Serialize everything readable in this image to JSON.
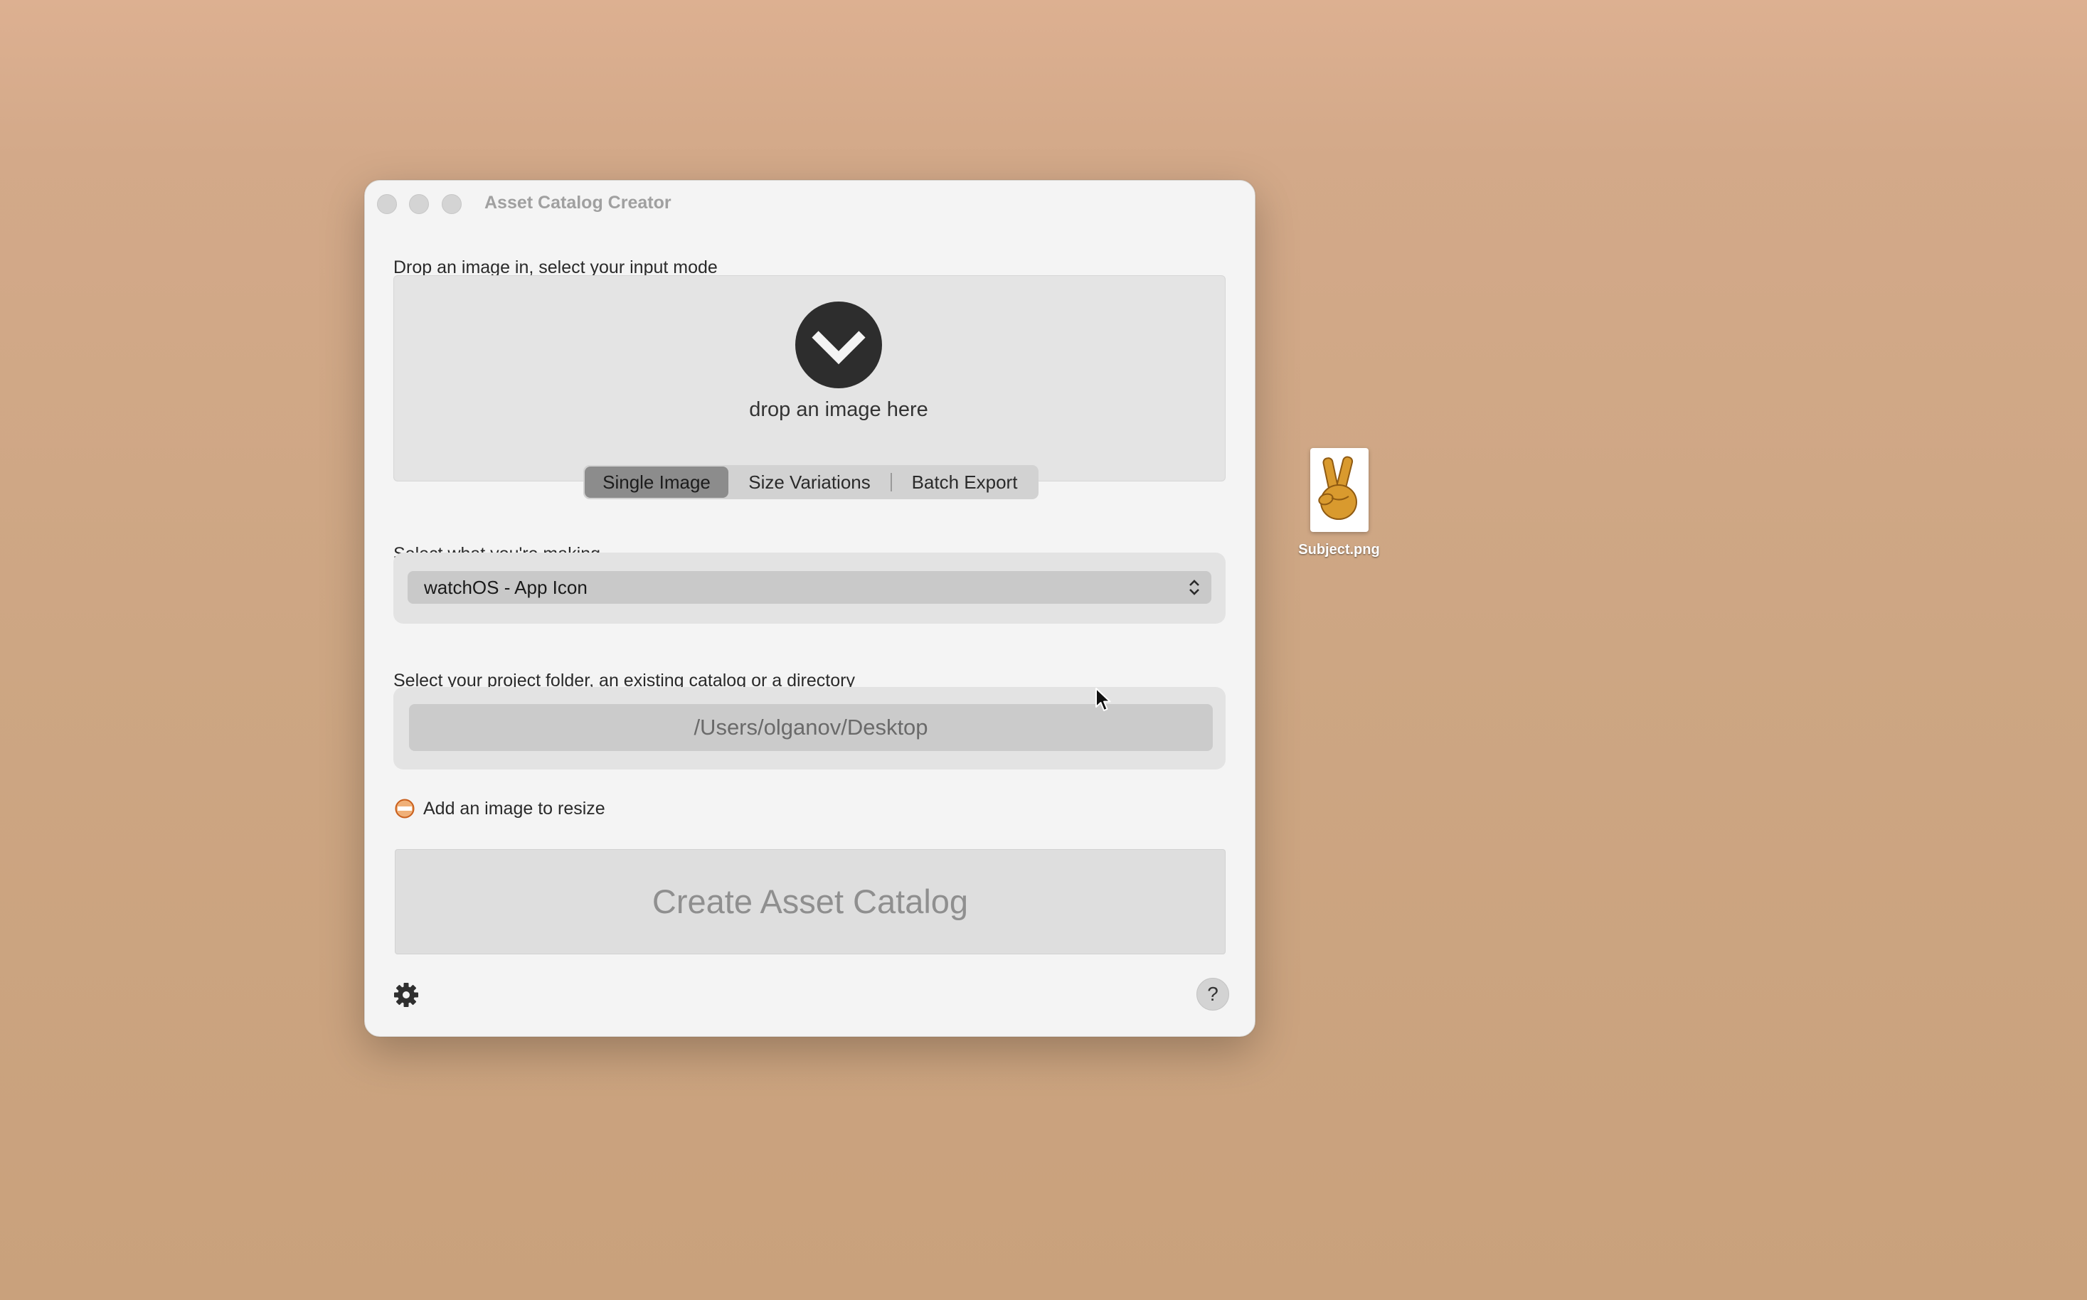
{
  "window": {
    "title": "Asset Catalog Creator"
  },
  "input": {
    "label": "Drop an image in, select your input mode",
    "drop_text": "drop an image here",
    "modes": [
      "Single Image",
      "Size Variations",
      "Batch Export"
    ],
    "selected_mode": "Single Image"
  },
  "target": {
    "label": "Select what you're making",
    "selected": "watchOS - App Icon"
  },
  "output": {
    "label": "Select your project folder, an existing catalog or a directory",
    "path": "/Users/olganov/Desktop"
  },
  "status": {
    "text": "Add an image to resize",
    "icon": "warning-icon",
    "color": "#e07b2a"
  },
  "actions": {
    "create_label": "Create Asset Catalog",
    "settings_icon": "gear-icon",
    "help_label": "?"
  },
  "desktop": {
    "file_name": "Subject.png",
    "file_icon": "peace-hand-emoji"
  }
}
